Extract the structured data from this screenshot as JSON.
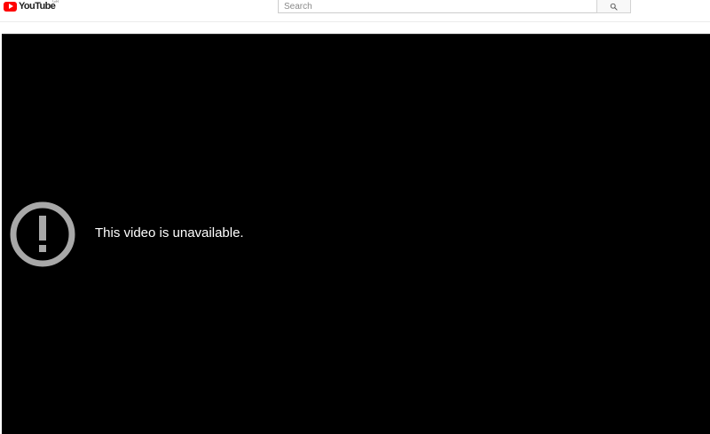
{
  "header": {
    "logo": {
      "text": "YouTube",
      "region": "GR"
    },
    "search": {
      "placeholder": "Search",
      "value": ""
    },
    "icons": {
      "logo": "youtube-play-icon",
      "search": "search-icon"
    }
  },
  "player": {
    "error_message": "This video is unavailable.",
    "error_icon": "error-exclamation-icon"
  },
  "colors": {
    "brand_red": "#ff0000",
    "player_bg": "#000000",
    "error_icon": "#a8a8a8",
    "error_text": "#ffffff"
  }
}
